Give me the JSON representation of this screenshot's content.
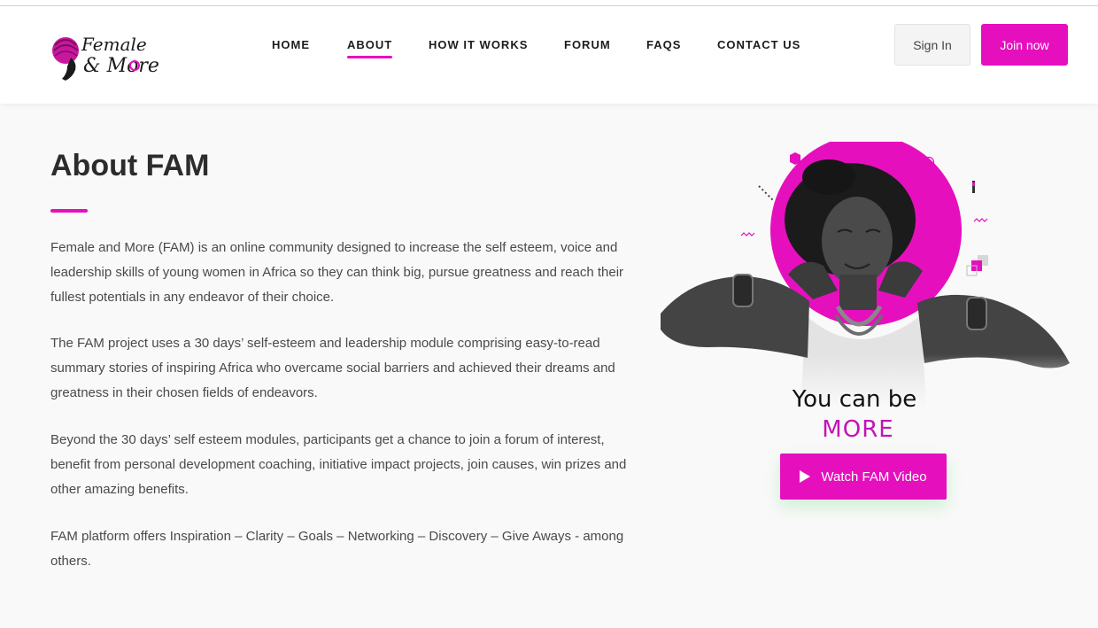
{
  "brand": {
    "logo_line1": "Female",
    "logo_line2": "& More",
    "accent_color": "#e60fbe"
  },
  "nav": {
    "items": [
      {
        "label": "HOME",
        "active": false
      },
      {
        "label": "ABOUT",
        "active": true
      },
      {
        "label": "HOW IT WORKS",
        "active": false
      },
      {
        "label": "FORUM",
        "active": false
      },
      {
        "label": "FAQS",
        "active": false
      },
      {
        "label": "CONTACT US",
        "active": false
      }
    ]
  },
  "header": {
    "signin_label": "Sign In",
    "join_label": "Join now"
  },
  "main": {
    "title": "About FAM",
    "paragraphs": [
      "Female and More (FAM) is an online community designed to increase the self esteem, voice and leadership skills of young women in Africa so they can think big, pursue greatness and reach their fullest potentials in any endeavor of their choice.",
      "The FAM project uses a 30 days’ self-esteem and leadership module comprising easy-to-read summary stories of inspiring Africa who overcame social barriers and achieved their dreams and greatness in their chosen fields of endeavors.",
      "Beyond the 30 days’ self esteem modules, participants get a chance to join a forum of interest, benefit from personal development coaching, initiative impact projects, join causes, win prizes and other amazing benefits.",
      "FAM platform offers Inspiration – Clarity – Goals – Networking – Discovery – Give Aways - among others."
    ]
  },
  "hero": {
    "tagline_line1": "You can be",
    "tagline_line2": "MORE",
    "video_button_label": "Watch FAM Video",
    "play_icon": "play-icon"
  }
}
